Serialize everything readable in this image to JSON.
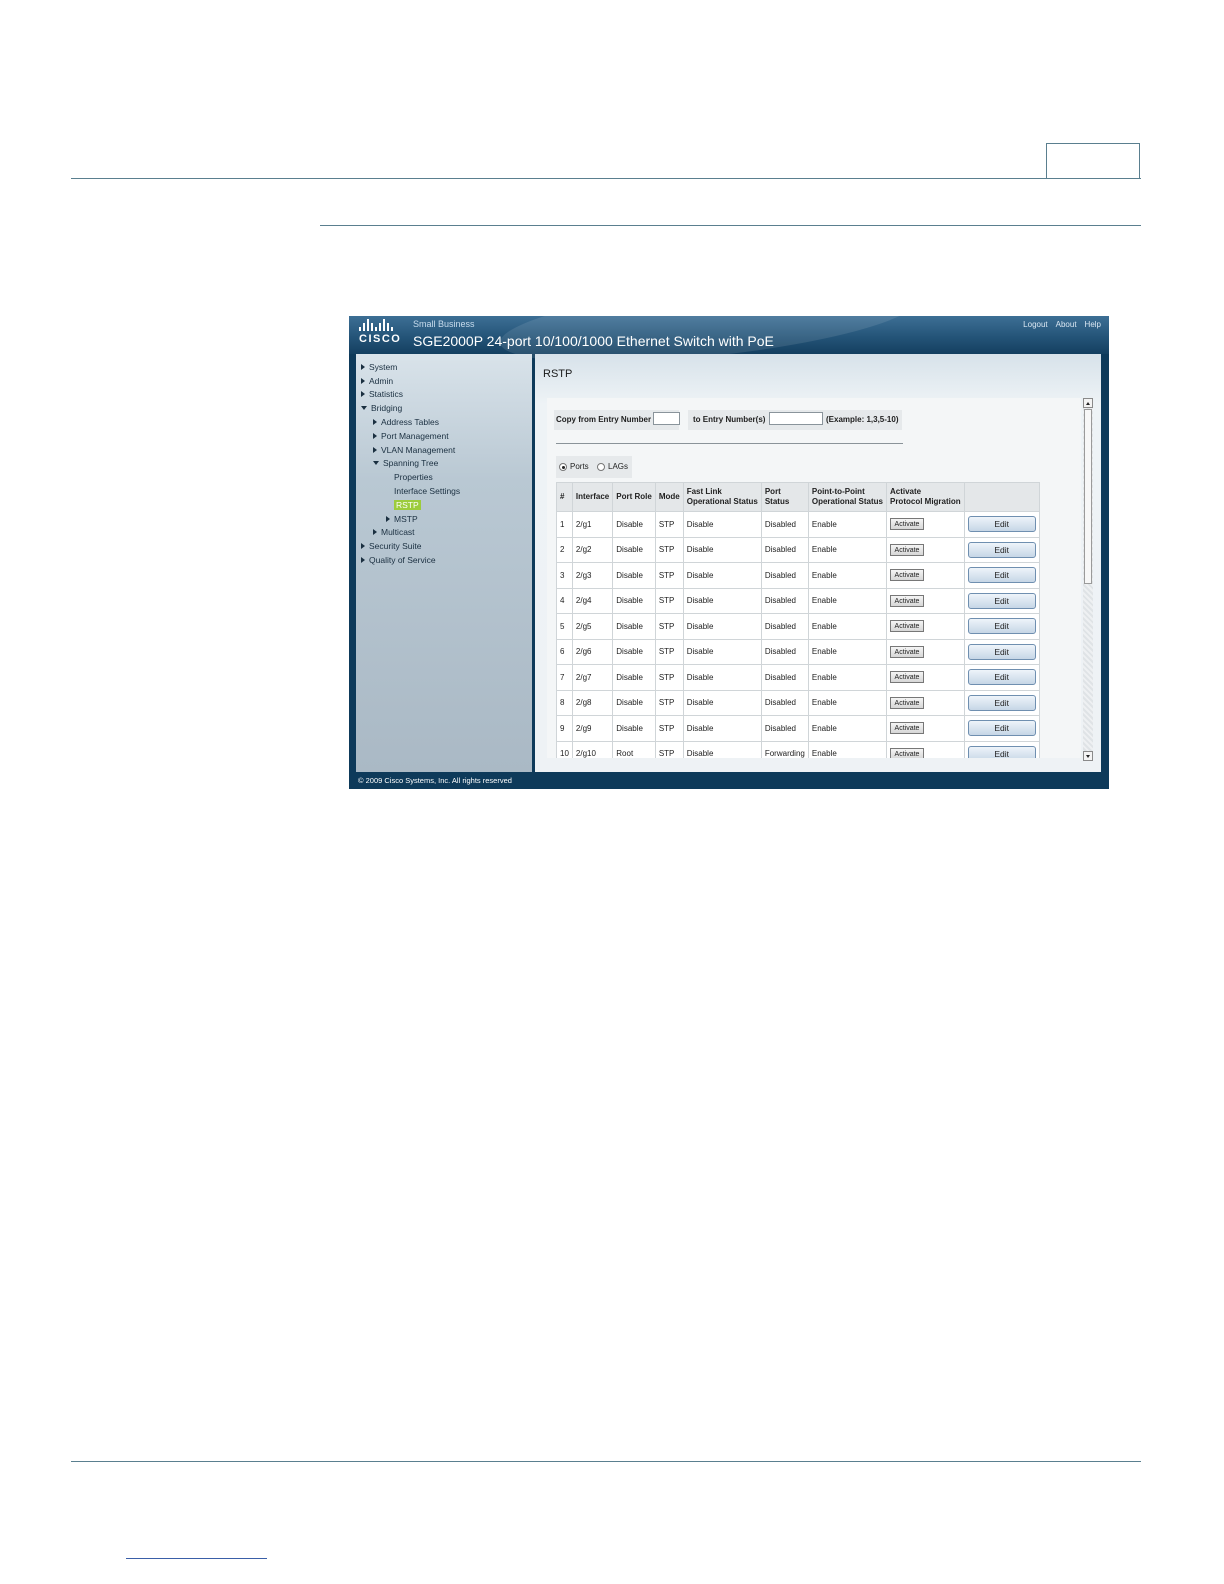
{
  "header": {
    "logo_text": "CISCO",
    "brand_label": "Small Business",
    "title": "SGE2000P 24-port 10/100/1000 Ethernet Switch with PoE",
    "links": [
      "Logout",
      "About",
      "Help"
    ]
  },
  "sidebar": {
    "items": [
      {
        "label": "System",
        "level": 1,
        "arrow": "right"
      },
      {
        "label": "Admin",
        "level": 1,
        "arrow": "right"
      },
      {
        "label": "Statistics",
        "level": 1,
        "arrow": "right"
      },
      {
        "label": "Bridging",
        "level": 1,
        "arrow": "down"
      },
      {
        "label": "Address Tables",
        "level": 2,
        "arrow": "right"
      },
      {
        "label": "Port Management",
        "level": 2,
        "arrow": "right"
      },
      {
        "label": "VLAN Management",
        "level": 2,
        "arrow": "right"
      },
      {
        "label": "Spanning Tree",
        "level": 2,
        "arrow": "down"
      },
      {
        "label": "Properties",
        "level": 3,
        "arrow": "none"
      },
      {
        "label": "Interface Settings",
        "level": 3,
        "arrow": "none"
      },
      {
        "label": "RSTP",
        "level": 3,
        "arrow": "none",
        "selected": true
      },
      {
        "label": "MSTP",
        "level": 3,
        "arrow": "right"
      },
      {
        "label": "Multicast",
        "level": 2,
        "arrow": "right"
      },
      {
        "label": "Security Suite",
        "level": 1,
        "arrow": "right"
      },
      {
        "label": "Quality of Service",
        "level": 1,
        "arrow": "right"
      }
    ]
  },
  "main": {
    "page_title": "RSTP",
    "copy": {
      "from_label": "Copy from Entry Number",
      "from_value": "",
      "to_label": "to Entry Number(s)",
      "to_value": "",
      "example": "(Example: 1,3,5-10)"
    },
    "view": {
      "ports_label": "Ports",
      "lags_label": "LAGs",
      "selected": "Ports"
    },
    "table": {
      "headers": [
        "#",
        "Interface",
        "Port Role",
        "Mode",
        "Fast Link Operational Status",
        "Port Status",
        "Point-to-Point Operational Status",
        "Activate Protocol Migration",
        ""
      ],
      "header_lines": [
        [
          "#"
        ],
        [
          "Interface"
        ],
        [
          "Port Role"
        ],
        [
          "Mode"
        ],
        [
          "Fast Link",
          "Operational Status"
        ],
        [
          "Port",
          "Status"
        ],
        [
          "Point-to-Point",
          "Operational Status"
        ],
        [
          "Activate",
          "Protocol Migration"
        ],
        [
          ""
        ]
      ],
      "activate_label": "Activate",
      "edit_label": "Edit",
      "rows": [
        [
          "1",
          "2/g1",
          "Disable",
          "STP",
          "Disable",
          "Disabled",
          "Enable"
        ],
        [
          "2",
          "2/g2",
          "Disable",
          "STP",
          "Disable",
          "Disabled",
          "Enable"
        ],
        [
          "3",
          "2/g3",
          "Disable",
          "STP",
          "Disable",
          "Disabled",
          "Enable"
        ],
        [
          "4",
          "2/g4",
          "Disable",
          "STP",
          "Disable",
          "Disabled",
          "Enable"
        ],
        [
          "5",
          "2/g5",
          "Disable",
          "STP",
          "Disable",
          "Disabled",
          "Enable"
        ],
        [
          "6",
          "2/g6",
          "Disable",
          "STP",
          "Disable",
          "Disabled",
          "Enable"
        ],
        [
          "7",
          "2/g7",
          "Disable",
          "STP",
          "Disable",
          "Disabled",
          "Enable"
        ],
        [
          "8",
          "2/g8",
          "Disable",
          "STP",
          "Disable",
          "Disabled",
          "Enable"
        ],
        [
          "9",
          "2/g9",
          "Disable",
          "STP",
          "Disable",
          "Disabled",
          "Enable"
        ],
        [
          "10",
          "2/g10",
          "Root",
          "STP",
          "Disable",
          "Forwarding",
          "Enable"
        ]
      ]
    }
  },
  "footer": {
    "copyright": "© 2009 Cisco Systems, Inc. All rights reserved"
  },
  "colors": {
    "header_blue": "#245478",
    "footer_navy": "#0e3a5a",
    "selected_green": "#9ccc3c",
    "doc_rule": "#5a7f8f"
  }
}
